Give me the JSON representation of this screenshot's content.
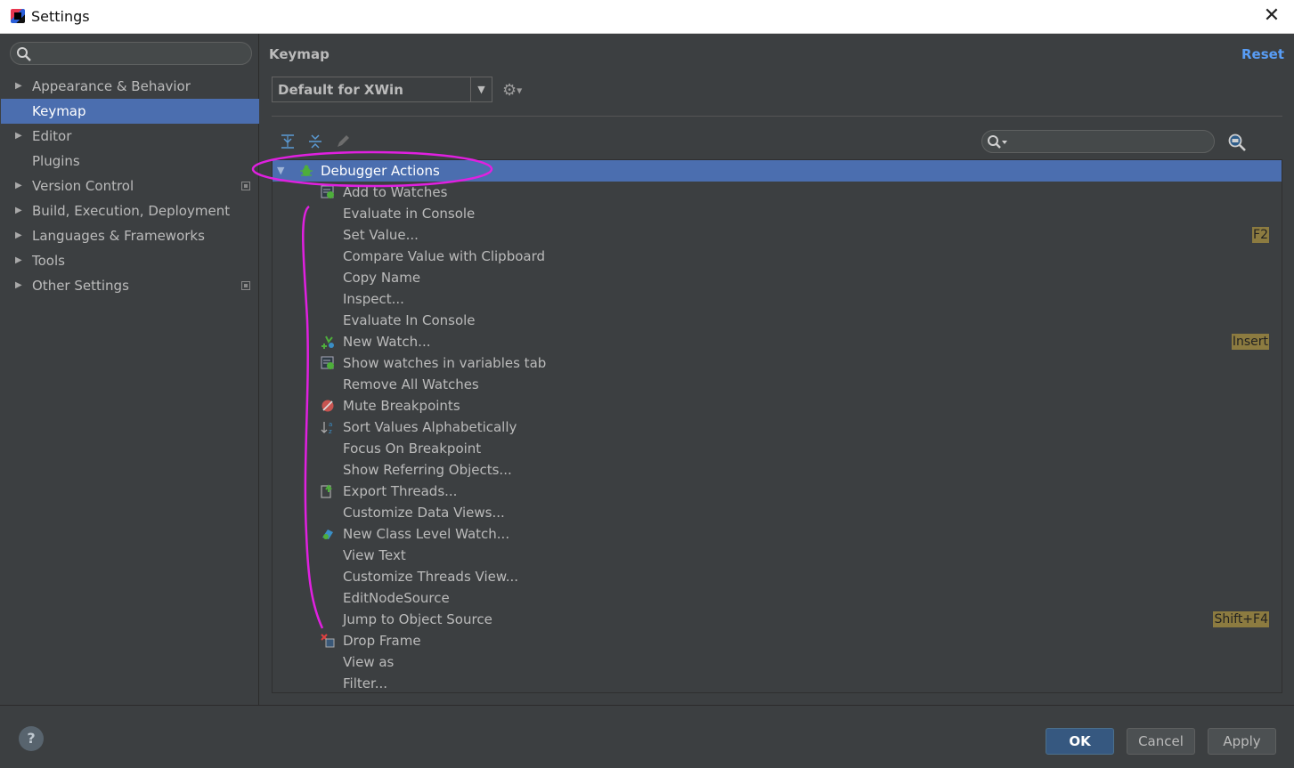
{
  "window": {
    "title": "Settings",
    "close_glyph": "✕"
  },
  "sidebar": {
    "search_placeholder": "",
    "items": [
      {
        "label": "Appearance & Behavior",
        "expandable": true,
        "selected": false,
        "project_icon": false
      },
      {
        "label": "Keymap",
        "expandable": false,
        "selected": true,
        "project_icon": false
      },
      {
        "label": "Editor",
        "expandable": true,
        "selected": false,
        "project_icon": false
      },
      {
        "label": "Plugins",
        "expandable": false,
        "selected": false,
        "project_icon": false
      },
      {
        "label": "Version Control",
        "expandable": true,
        "selected": false,
        "project_icon": true
      },
      {
        "label": "Build, Execution, Deployment",
        "expandable": true,
        "selected": false,
        "project_icon": false
      },
      {
        "label": "Languages & Frameworks",
        "expandable": true,
        "selected": false,
        "project_icon": false
      },
      {
        "label": "Tools",
        "expandable": true,
        "selected": false,
        "project_icon": false
      },
      {
        "label": "Other Settings",
        "expandable": true,
        "selected": false,
        "project_icon": true
      }
    ]
  },
  "main": {
    "title": "Keymap",
    "reset_label": "Reset",
    "keymap_value": "Default for XWin",
    "search_placeholder": "",
    "tree": {
      "group": {
        "label": "Debugger Actions",
        "expanded": true,
        "icon": "bug-icon"
      },
      "actions": [
        {
          "label": "Add to Watches",
          "icon": "watch-icon",
          "shortcut": ""
        },
        {
          "label": "Evaluate in Console",
          "icon": "",
          "shortcut": ""
        },
        {
          "label": "Set Value...",
          "icon": "",
          "shortcut": "F2"
        },
        {
          "label": "Compare Value with Clipboard",
          "icon": "",
          "shortcut": ""
        },
        {
          "label": "Copy Name",
          "icon": "",
          "shortcut": ""
        },
        {
          "label": "Inspect...",
          "icon": "",
          "shortcut": ""
        },
        {
          "label": "Evaluate In Console",
          "icon": "",
          "shortcut": ""
        },
        {
          "label": "New Watch...",
          "icon": "new-watch-icon",
          "shortcut": "Insert"
        },
        {
          "label": "Show watches in variables tab",
          "icon": "watch-icon",
          "shortcut": ""
        },
        {
          "label": "Remove All Watches",
          "icon": "",
          "shortcut": ""
        },
        {
          "label": "Mute Breakpoints",
          "icon": "mute-breakpoints-icon",
          "shortcut": ""
        },
        {
          "label": "Sort Values Alphabetically",
          "icon": "sort-alpha-icon",
          "shortcut": ""
        },
        {
          "label": "Focus On Breakpoint",
          "icon": "",
          "shortcut": ""
        },
        {
          "label": "Show Referring Objects...",
          "icon": "",
          "shortcut": ""
        },
        {
          "label": "Export Threads...",
          "icon": "export-icon",
          "shortcut": ""
        },
        {
          "label": "Customize Data Views...",
          "icon": "",
          "shortcut": ""
        },
        {
          "label": "New Class Level Watch...",
          "icon": "class-watch-icon",
          "shortcut": ""
        },
        {
          "label": "View Text",
          "icon": "",
          "shortcut": ""
        },
        {
          "label": "Customize Threads View...",
          "icon": "",
          "shortcut": ""
        },
        {
          "label": "EditNodeSource",
          "icon": "",
          "shortcut": ""
        },
        {
          "label": "Jump to Object Source",
          "icon": "",
          "shortcut": "Shift+F4"
        },
        {
          "label": "Drop Frame",
          "icon": "drop-frame-icon",
          "shortcut": ""
        },
        {
          "label": "View as",
          "icon": "",
          "shortcut": ""
        },
        {
          "label": "Filter...",
          "icon": "",
          "shortcut": ""
        }
      ]
    }
  },
  "buttons": {
    "ok": "OK",
    "cancel": "Cancel",
    "apply": "Apply",
    "help": "?"
  },
  "colors": {
    "background": "#3c3f41",
    "selection": "#4b6eaf",
    "link": "#589df6",
    "shortcut_badge": "#8c7b40",
    "annotation": "#e020e0"
  }
}
